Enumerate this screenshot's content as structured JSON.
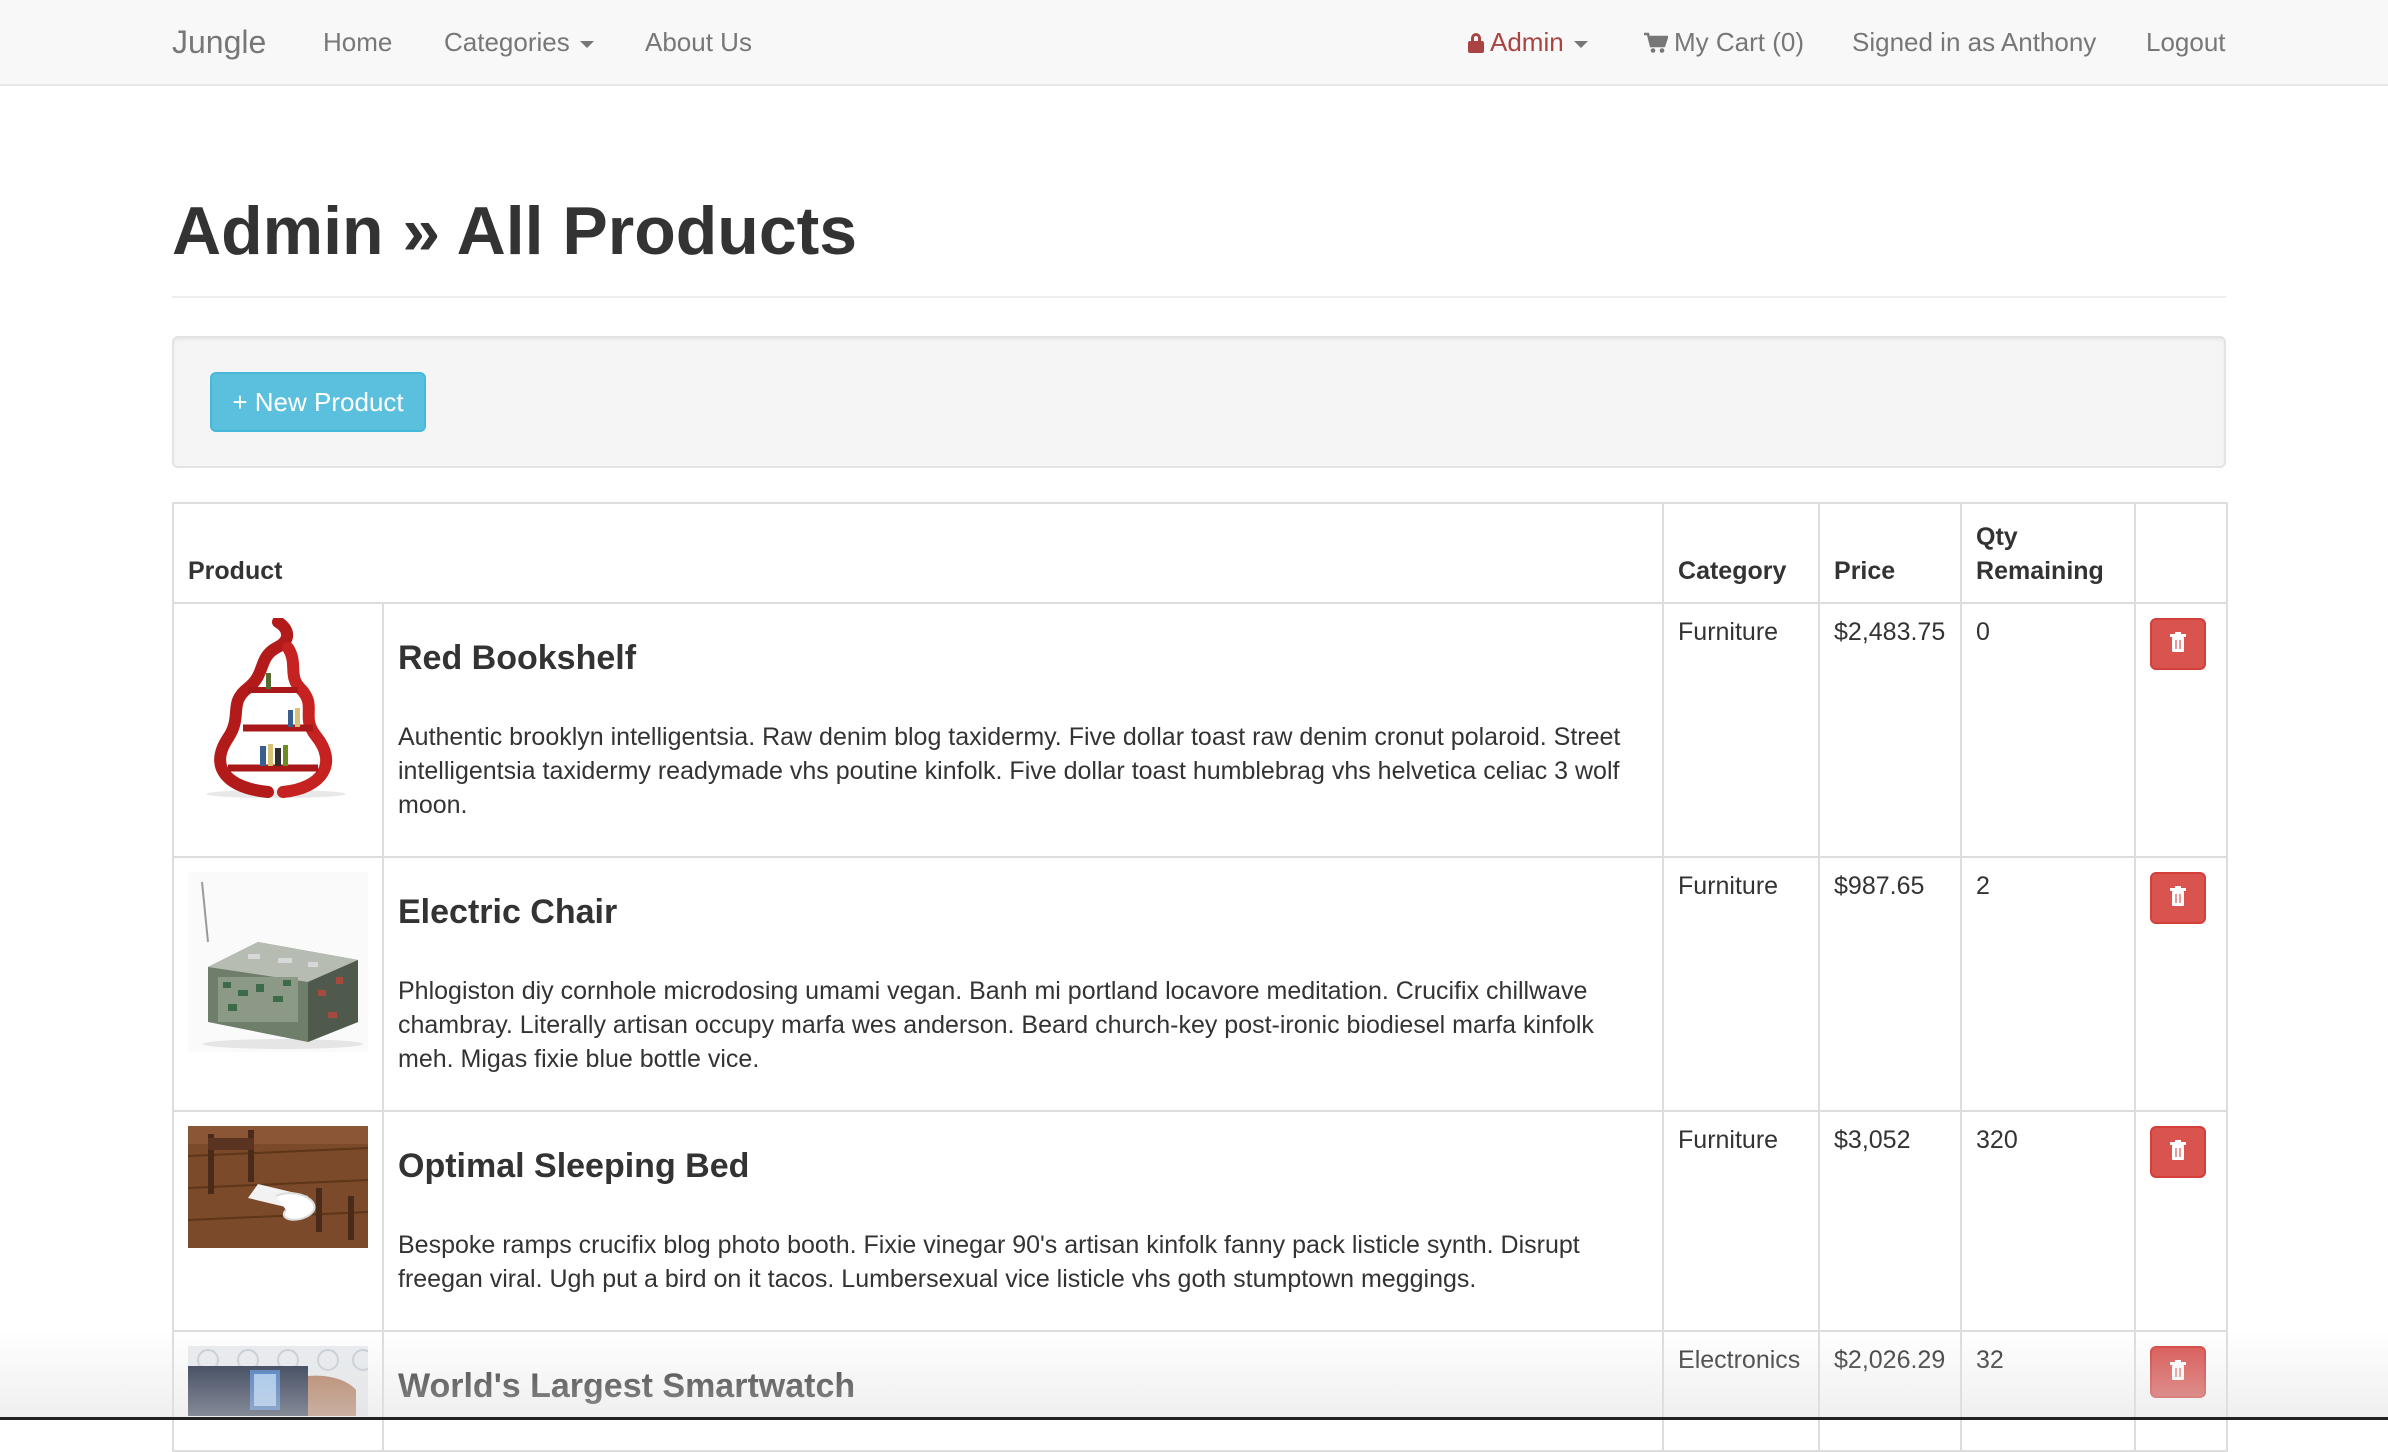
{
  "navbar": {
    "brand": "Jungle",
    "home": "Home",
    "categories": "Categories",
    "about": "About Us",
    "admin": "Admin",
    "cart": "My Cart (0)",
    "signed_in": "Signed in as Anthony",
    "logout": "Logout"
  },
  "page": {
    "title": "Admin » All Products",
    "new_product_button": "+ New Product"
  },
  "table": {
    "headers": {
      "product": "Product",
      "category": "Category",
      "price": "Price",
      "qty": "Qty Remaining"
    },
    "rows": [
      {
        "name": "Red Bookshelf",
        "description": "Authentic brooklyn intelligentsia. Raw denim blog taxidermy. Five dollar toast raw denim cronut polaroid. Street intelligentsia taxidermy readymade vhs poutine kinfolk. Five dollar toast humblebrag vhs helvetica celiac 3 wolf moon.",
        "category": "Furniture",
        "price": "$2,483.75",
        "qty": "0"
      },
      {
        "name": "Electric Chair",
        "description": "Phlogiston diy cornhole microdosing umami vegan. Banh mi portland locavore meditation. Crucifix chillwave chambray. Literally artisan occupy marfa wes anderson. Beard church-key post-ironic biodiesel marfa kinfolk meh. Migas fixie blue bottle vice.",
        "category": "Furniture",
        "price": "$987.65",
        "qty": "2"
      },
      {
        "name": "Optimal Sleeping Bed",
        "description": "Bespoke ramps crucifix blog photo booth. Fixie vinegar 90's artisan kinfolk fanny pack listicle synth. Disrupt freegan viral. Ugh put a bird on it tacos. Lumbersexual vice listicle vhs goth stumptown meggings.",
        "category": "Furniture",
        "price": "$3,052",
        "qty": "320"
      },
      {
        "name": "World's Largest Smartwatch",
        "description": "",
        "category": "Electronics",
        "price": "$2,026.29",
        "qty": "32"
      }
    ]
  },
  "colors": {
    "navbar_bg": "#f8f8f8",
    "admin_link": "#a94442",
    "info_button": "#5bc0de",
    "danger_button": "#d9534f"
  },
  "icons": [
    "lock-icon",
    "cart-icon",
    "trash-icon",
    "caret-down-icon"
  ]
}
